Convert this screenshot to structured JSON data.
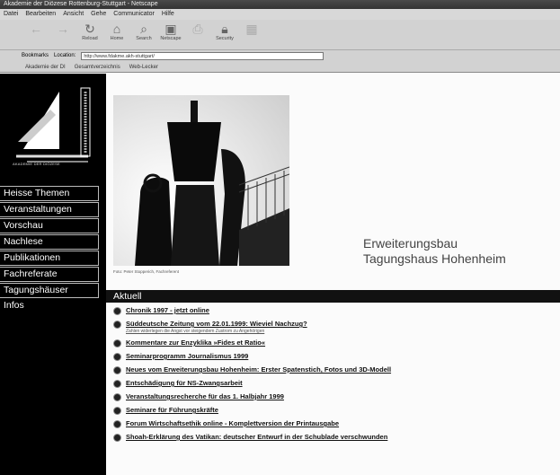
{
  "window": {
    "title": "Akademie der Diözese Rottenburg-Stuttgart - Netscape"
  },
  "menu": [
    "Datei",
    "Bearbeiten",
    "Ansicht",
    "Gehe",
    "Communicator",
    "Hilfe"
  ],
  "toolbar": {
    "buttons": [
      {
        "label": "",
        "icon": "back-icon"
      },
      {
        "label": "",
        "icon": "forward-icon"
      },
      {
        "label": "Reload",
        "icon": "reload-icon"
      },
      {
        "label": "Home",
        "icon": "home-icon"
      },
      {
        "label": "Search",
        "icon": "search-icon"
      },
      {
        "label": "Netscape",
        "icon": "netscape-icon"
      },
      {
        "label": "",
        "icon": "print-icon"
      },
      {
        "label": "Security",
        "icon": "security-icon"
      },
      {
        "label": "",
        "icon": "stop-icon"
      }
    ]
  },
  "location": {
    "bookmarks_label": "Bookmarks",
    "location_label": "Location:",
    "url": "http://www.fdakme.akh-stuttgart/"
  },
  "linkbar": [
    "Akademie der DI",
    "Gesamtverzeichnis",
    "Web-Lecker"
  ],
  "sidebar": {
    "logo_caption": "AKADEMIE DER DIÖZESE",
    "nav": [
      {
        "label": "Heisse Themen"
      },
      {
        "label": "Veranstaltungen"
      },
      {
        "label": "Vorschau"
      },
      {
        "label": "Nachlese"
      },
      {
        "label": "Publikationen"
      },
      {
        "label": "Fachreferate"
      },
      {
        "label": "Tagungshäuser"
      },
      {
        "label": "Infos"
      }
    ]
  },
  "main": {
    "photo_caption": "Foto: Peter Stopperich, Fachreferent",
    "headline_line1": "Erweiterungsbau",
    "headline_line2": "Tagungshaus Hohenheim",
    "section_title": "Aktuell",
    "news": [
      {
        "text": "Chronik 1997 - jetzt online",
        "sub": ""
      },
      {
        "text": "Süddeutsche Zeitung vom 22.01.1999: Wieviel Nachzug?",
        "sub": "Zahlen widerlegen die Angst vor steigendem Zustrom zu Angehörigen"
      },
      {
        "text": "Kommentare zur Enzyklika »Fides et Ratio«",
        "sub": ""
      },
      {
        "text": "Seminarprogramm Journalismus 1999",
        "sub": ""
      },
      {
        "text": "Neues vom Erweiterungsbau Hohenheim: Erster Spatenstich, Fotos und 3D-Modell",
        "sub": ""
      },
      {
        "text": "Entschädigung für NS-Zwangsarbeit",
        "sub": ""
      },
      {
        "text": "Veranstaltungsrecherche für das 1. Halbjahr 1999",
        "sub": ""
      },
      {
        "text": "Seminare für Führungskräfte",
        "sub": ""
      },
      {
        "text": "Forum Wirtschaftsethik online - Komplettversion der Printausgabe",
        "sub": ""
      },
      {
        "text": "Shoah-Erklärung des Vatikan: deutscher Entwurf in der Schublade verschwunden",
        "sub": ""
      }
    ]
  }
}
